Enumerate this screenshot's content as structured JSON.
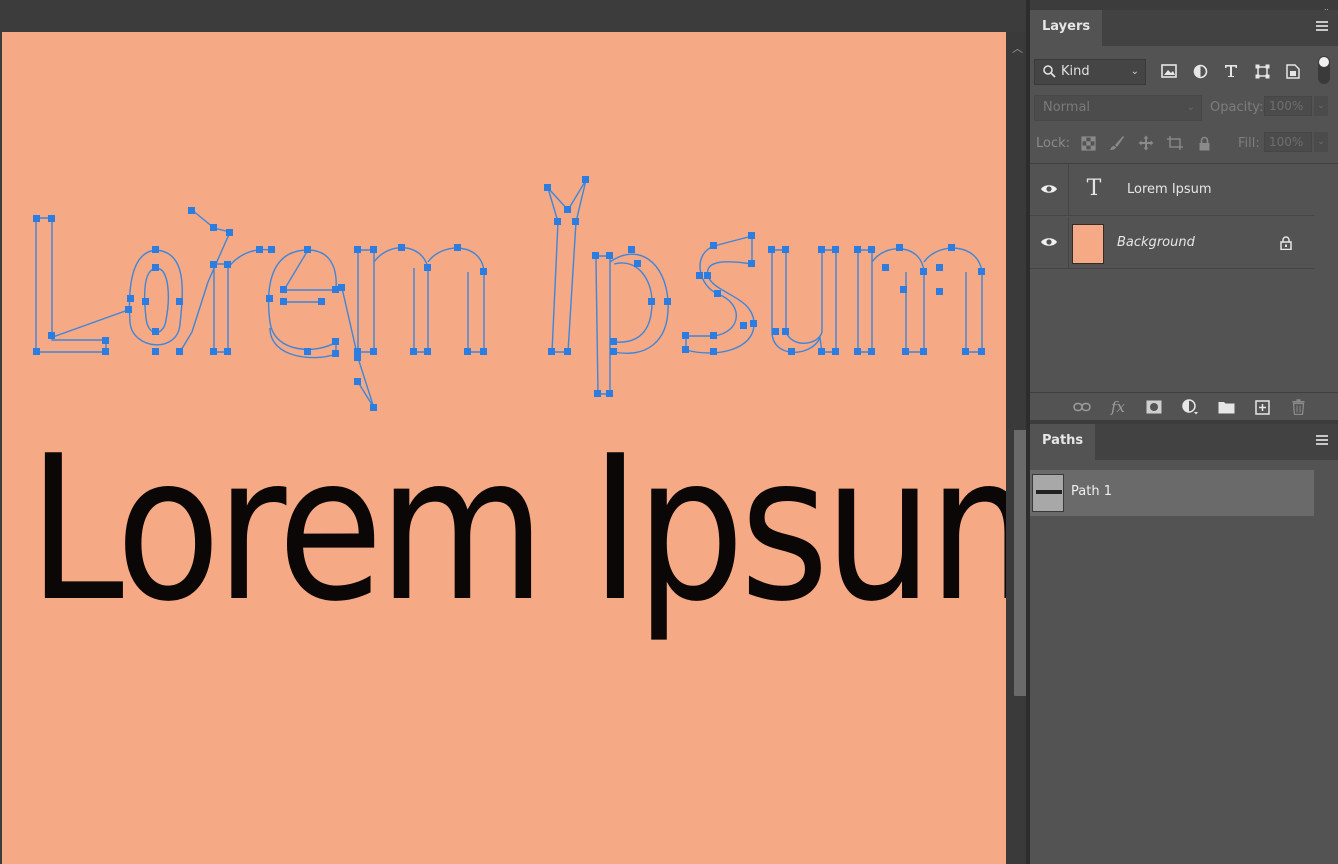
{
  "canvas": {
    "background": "#f6a985",
    "text": "Lorem Ipsum",
    "text_color": "#0b0706",
    "path_color": "#2b7de1"
  },
  "topbar": {
    "collapse_glyph": "»"
  },
  "layers_panel": {
    "tab": "Layers",
    "kind_filter": {
      "value": "Kind"
    },
    "filter_icons": [
      "pixel-layer-icon",
      "adjustment-layer-icon",
      "type-layer-icon",
      "shape-layer-icon",
      "smart-object-icon"
    ],
    "blend_mode": "Normal",
    "opacity_label": "Opacity:",
    "opacity_value": "100%",
    "lock_label": "Lock:",
    "fill_label": "Fill:",
    "fill_value": "100%",
    "layers": [
      {
        "name": "Lorem Ipsum",
        "type": "text",
        "visible": true
      },
      {
        "name": "Background",
        "type": "background",
        "visible": true,
        "locked": true
      }
    ],
    "footer_icons": [
      "link-icon",
      "fx-icon",
      "mask-icon",
      "adjustment-icon",
      "folder-icon",
      "new-layer-icon",
      "trash-icon"
    ],
    "fx_label": "fx"
  },
  "paths_panel": {
    "tab": "Paths",
    "paths": [
      {
        "name": "Path 1",
        "selected": true
      }
    ]
  }
}
